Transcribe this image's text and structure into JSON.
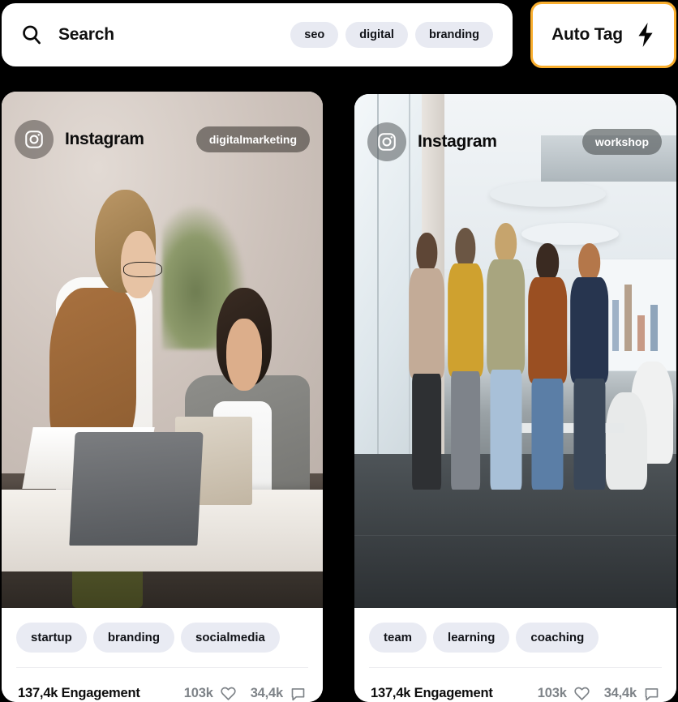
{
  "search": {
    "icon": "search-icon",
    "label": "Search",
    "placeholder": "Search",
    "suggested_tags": [
      "seo",
      "digital",
      "branding"
    ]
  },
  "auto_tag": {
    "label": "Auto Tag",
    "icon": "lightning-bolt-icon",
    "border_color": "#f9ae2e"
  },
  "theme": {
    "background": "#000000",
    "card_background": "#ffffff",
    "chip_background": "#e9ebf3",
    "chip_text": "#111318",
    "muted_text": "#7e8388",
    "accent": "#f9ae2e"
  },
  "cards": [
    {
      "source": "Instagram",
      "source_icon": "instagram-icon",
      "overlay_tag": "digitalmarketing",
      "image_alt": "Two women collaborating at a desk with a laptop and notebook",
      "tags": [
        "startup",
        "branding",
        "socialmedia"
      ],
      "engagement": "137,4k Engagement",
      "metrics": [
        {
          "value": "103k",
          "icon": "heart-icon"
        },
        {
          "value": "34,4k",
          "icon": "comment-icon"
        }
      ]
    },
    {
      "source": "Instagram",
      "source_icon": "instagram-icon",
      "overlay_tag": "workshop",
      "image_alt": "Team of five people standing together in a bright modern office",
      "tags": [
        "team",
        "learning",
        "coaching"
      ],
      "engagement": "137,4k Engagement",
      "metrics": [
        {
          "value": "103k",
          "icon": "heart-icon"
        },
        {
          "value": "34,4k",
          "icon": "comment-icon"
        }
      ]
    }
  ]
}
